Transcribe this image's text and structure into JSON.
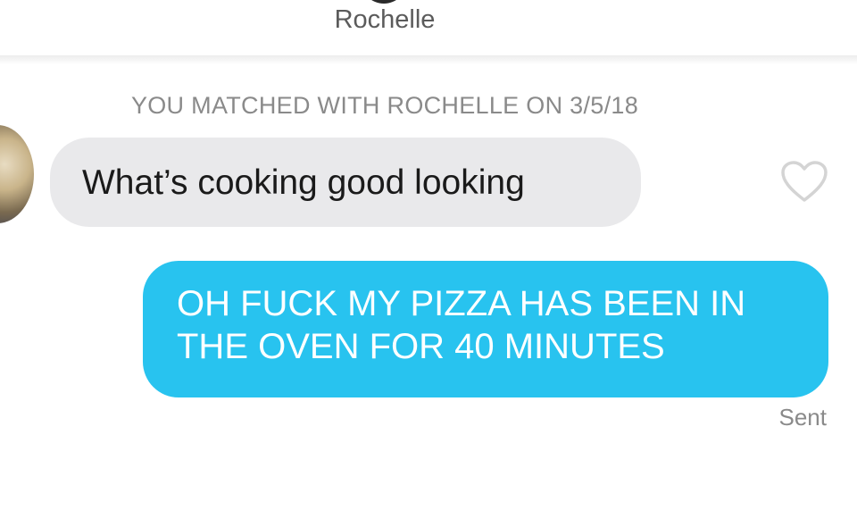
{
  "header": {
    "contact_name": "Rochelle"
  },
  "conversation": {
    "match_notice": "YOU MATCHED WITH ROCHELLE ON 3/5/18",
    "messages": [
      {
        "direction": "received",
        "text": "What’s cooking good looking",
        "icon": "heart-outline-icon"
      },
      {
        "direction": "sent",
        "lines": [
          "OH FUCK MY PIZZA HAS BEEN IN",
          "THE OVEN FOR 40 MINUTES"
        ],
        "status": "Sent"
      }
    ]
  },
  "colors": {
    "sent_bubble": "#28c3ef",
    "received_bubble": "#e9e9eb",
    "muted_text": "#8a8a8a"
  }
}
